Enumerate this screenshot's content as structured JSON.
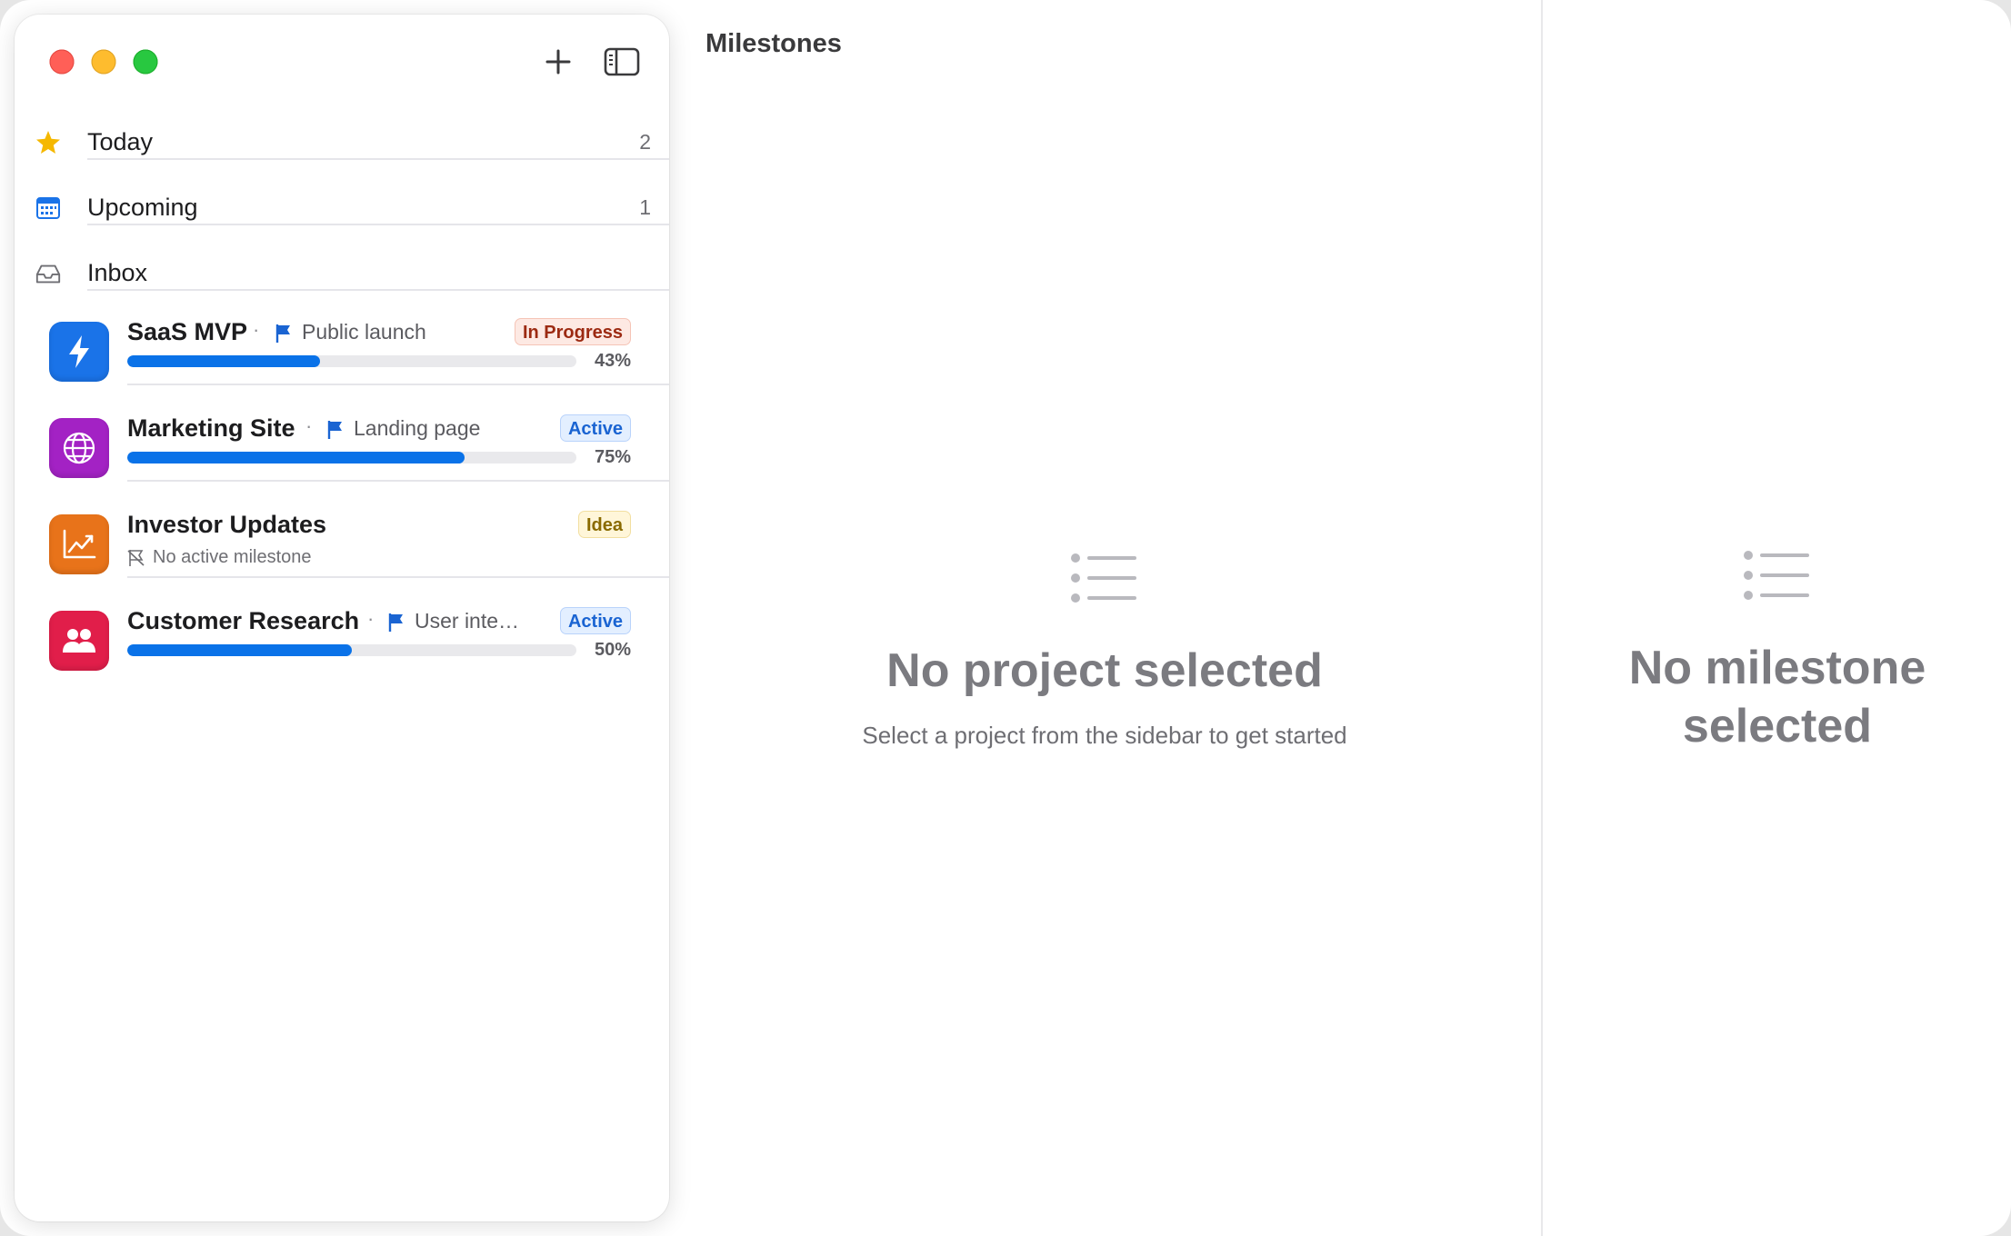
{
  "window": {
    "title": "Milestones"
  },
  "colors": {
    "accent": "#0a72e8",
    "today_star": "#f5b800",
    "upcoming_cal": "#1a73e8"
  },
  "nav": [
    {
      "label": "Today",
      "count": "2",
      "icon": "star-icon"
    },
    {
      "label": "Upcoming",
      "count": "1",
      "icon": "calendar-icon"
    },
    {
      "label": "Inbox",
      "count": "",
      "icon": "inbox-icon"
    }
  ],
  "projects": [
    {
      "name": "SaaS MVP",
      "milestone": "Public launch",
      "status": "In Progress",
      "progress": 0.43,
      "progress_label": "43%",
      "icon": "bolt-icon",
      "color": "#1a73e8"
    },
    {
      "name": "Marketing Site",
      "milestone": "Landing page",
      "status": "Active",
      "progress": 0.75,
      "progress_label": "75%",
      "icon": "globe-icon",
      "color": "#a322c4"
    },
    {
      "name": "Investor Updates",
      "milestone": "",
      "no_milestone_text": "No active milestone",
      "status": "Idea",
      "icon": "chart-line-icon",
      "color": "#e8731a"
    },
    {
      "name": "Customer Research",
      "milestone": "User inte…",
      "status": "Active",
      "progress": 0.5,
      "progress_label": "50%",
      "icon": "people-icon",
      "color": "#e11e4a"
    }
  ],
  "main": {
    "empty_title": "No project selected",
    "empty_subtitle": "Select a project from the sidebar to get started"
  },
  "detail": {
    "empty_title_line1": "No milestone",
    "empty_title_line2": "selected"
  }
}
